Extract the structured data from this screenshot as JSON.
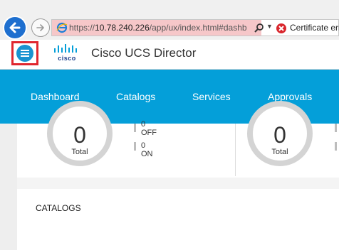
{
  "browser": {
    "url_scheme": "https://",
    "url_host": "10.78.240.226",
    "url_path": "/app/ux/index.html#dashb",
    "cert_text": "Certificate err",
    "icons": [
      "back-arrow-icon",
      "forward-arrow-icon",
      "ie-icon",
      "search-icon",
      "dropdown-arrow-icon",
      "certificate-error-icon"
    ]
  },
  "app": {
    "logo_text": "cisco",
    "title": "Cisco UCS Director"
  },
  "nav": {
    "items": [
      "Dashboard",
      "Catalogs",
      "Services",
      "Approvals"
    ]
  },
  "stats": {
    "left": {
      "value": "0",
      "label": "Total",
      "legend_top": "0",
      "legend_top_label": "OFF",
      "legend_bottom": "0",
      "legend_bottom_label": "ON"
    },
    "right": {
      "value": "0",
      "label": "Total"
    }
  },
  "catalogs": {
    "title": "CATALOGS"
  },
  "colors": {
    "accent": "#049fd9",
    "highlight_box": "#e0262e",
    "url_error_bg": "#f6c7c9"
  }
}
